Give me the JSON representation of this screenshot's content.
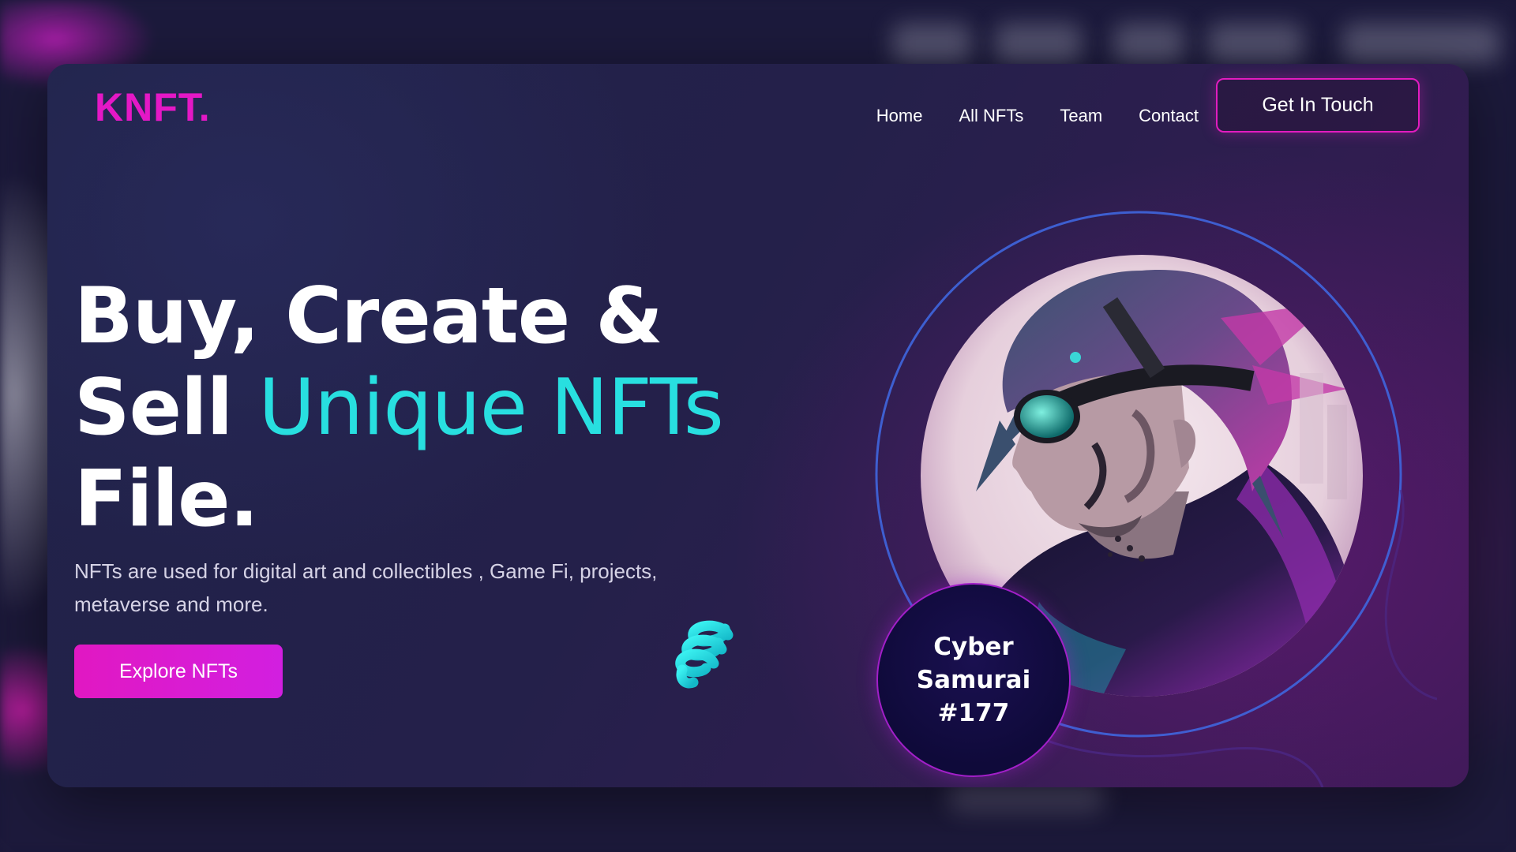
{
  "brand": {
    "logo": "KNFT."
  },
  "nav": {
    "items": [
      {
        "label": "Home"
      },
      {
        "label": "All NFTs"
      },
      {
        "label": "Team"
      },
      {
        "label": "Contact"
      }
    ],
    "cta_label": "Get In Touch"
  },
  "hero": {
    "headline_line1": "Buy, Create &",
    "headline_line2_plain": "Sell",
    "headline_line2_accent": "Unique NFTs",
    "headline_line3": "File.",
    "description": "NFTs are used for digital art and collectibles , Game Fi, projects, metaverse and more.",
    "explore_label": "Explore NFTs",
    "spiral_icon": "spiral-icon"
  },
  "featured": {
    "badge_line1": "Cyber",
    "badge_line2": "Samurai",
    "badge_line3": "#177",
    "image_icon": "cyber-samurai-portrait"
  },
  "colors": {
    "brand_pink": "#e418c6",
    "accent_cyan": "#28dfe0",
    "ring_blue": "#3a6de0",
    "background": "#1a1838"
  }
}
